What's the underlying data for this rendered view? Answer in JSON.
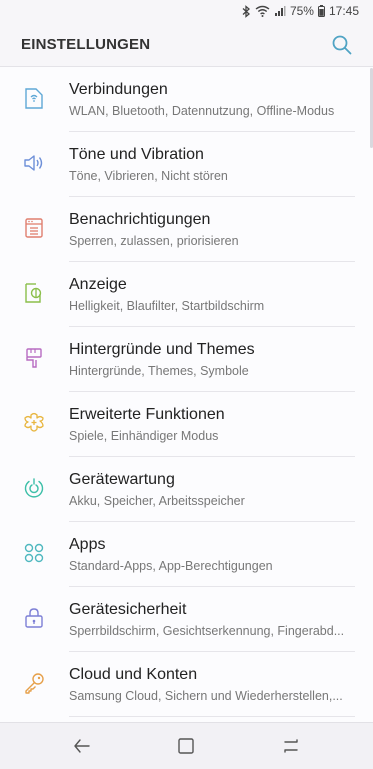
{
  "status": {
    "battery": "75%",
    "time": "17:45"
  },
  "header": {
    "title": "EINSTELLUNGEN"
  },
  "items": [
    {
      "title": "Verbindungen",
      "subtitle": "WLAN, Bluetooth, Datennutzung, Offline-Modus",
      "icon": "connections-icon",
      "color": "#5fa8d6"
    },
    {
      "title": "Töne und Vibration",
      "subtitle": "Töne, Vibrieren, Nicht stören",
      "icon": "sound-icon",
      "color": "#6d8fd8"
    },
    {
      "title": "Benachrichtigungen",
      "subtitle": "Sperren, zulassen, priorisieren",
      "icon": "notifications-icon",
      "color": "#e07f6f"
    },
    {
      "title": "Anzeige",
      "subtitle": "Helligkeit, Blaufilter, Startbildschirm",
      "icon": "display-icon",
      "color": "#8bbf4a"
    },
    {
      "title": "Hintergründe und Themes",
      "subtitle": "Hintergründe, Themes, Symbole",
      "icon": "brush-icon",
      "color": "#b86cc2"
    },
    {
      "title": "Erweiterte Funktionen",
      "subtitle": "Spiele, Einhändiger Modus",
      "icon": "puzzle-icon",
      "color": "#e8b640"
    },
    {
      "title": "Gerätewartung",
      "subtitle": "Akku, Speicher, Arbeitsspeicher",
      "icon": "maintenance-icon",
      "color": "#3dbfa8"
    },
    {
      "title": "Apps",
      "subtitle": "Standard-Apps, App-Berechtigungen",
      "icon": "apps-icon",
      "color": "#4fb8bf"
    },
    {
      "title": "Gerätesicherheit",
      "subtitle": "Sperrbildschirm, Gesichtserkennung, Fingerabd...",
      "icon": "lock-icon",
      "color": "#7d7fd6"
    },
    {
      "title": "Cloud und Konten",
      "subtitle": "Samsung Cloud, Sichern und Wiederherstellen,...",
      "icon": "key-icon",
      "color": "#e6a04a"
    }
  ],
  "navbar": {
    "back": "back-icon",
    "home": "home-icon",
    "recents": "recents-icon"
  }
}
